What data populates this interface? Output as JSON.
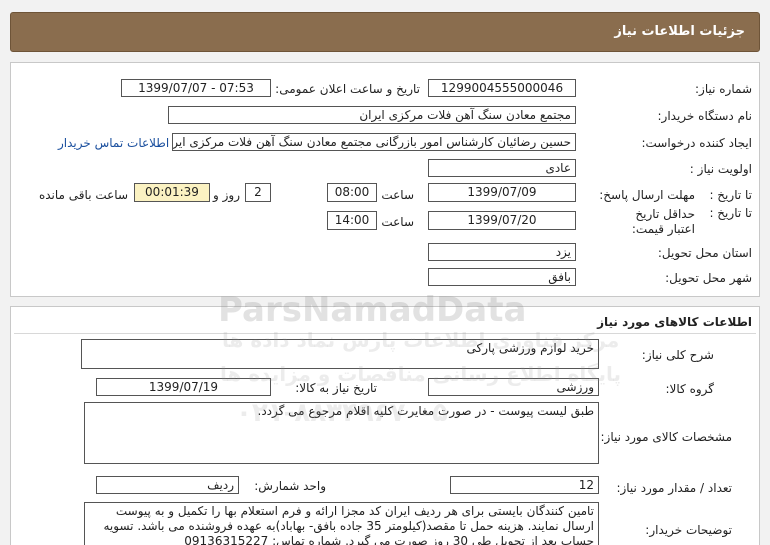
{
  "header": {
    "title": "جزئیات اطلاعات نیاز"
  },
  "general": {
    "need_number_label": "شماره نیاز:",
    "need_number": "1299004555000046",
    "announce_label": "تاریخ و ساعت اعلان عمومی:",
    "announce_value": "1399/07/07 - 07:53",
    "buyer_org_label": "نام دستگاه خریدار:",
    "buyer_org": "مجتمع معادن سنگ آهن فلات مرکزی ایران",
    "requester_label": "ایجاد کننده درخواست:",
    "requester": "حسین رضائیان کارشناس امور بازرگانی مجتمع معادن سنگ آهن فلات مرکزی ایران",
    "contact_link": "اطلاعات تماس خریدار",
    "priority_label": "اولویت نیاز :",
    "priority": "عادی",
    "deadline_label": "مهلت ارسال پاسخ:",
    "to_date_label": "تا تاریخ :",
    "deadline_date": "1399/07/09",
    "time_label": "ساعت",
    "deadline_time": "08:00",
    "days_value": "2",
    "days_label": "روز و",
    "remaining_value": "00:01:39",
    "remaining_label": "ساعت باقی مانده",
    "validity_label": "حداقل تاریخ اعتبار قیمت:",
    "validity_date": "1399/07/20",
    "validity_time": "14:00",
    "province_label": "استان محل تحویل:",
    "province": "یزد",
    "city_label": "شهر محل تحویل:",
    "city": "بافق"
  },
  "goods": {
    "section_title": "اطلاعات کالاهای مورد نیاز",
    "summary_label": "شرح کلی نیاز:",
    "summary": "خرید لوازم ورزشی پارکی",
    "group_label": "گروه کالا:",
    "group": "ورزشی",
    "need_date_label": "تاریخ نیاز به کالا:",
    "need_date": "1399/07/19",
    "specs_label": "مشخصات کالای مورد نیاز:",
    "specs": "طبق لیست پیوست - در صورت مغایرت کلیه اقلام مرجوع می گردد.",
    "qty_label": "تعداد / مقدار مورد نیاز:",
    "qty": "12",
    "unit_label": "واحد شمارش:",
    "unit": "ردیف",
    "notes_label": "توضیحات خریدار:",
    "notes": "تامین کنندگان بایستی برای هر ردیف ایران کد مجزا ارائه و فرم استعلام بها را تکمیل و به پیوست ارسال نمایند. هزینه حمل تا مقصد(کیلومتر 35 جاده بافق- بهاباد)به عهده فروشنده می باشد. تسویه حساب بعد از تحویل طی 30 روز صورت می گیرد. شماره تماس: 09136315227"
  },
  "watermark": {
    "brand": "ParsNamadData",
    "line1": "مرکز فناوری اطلاعات پارس نماد داده ها",
    "line2": "پایگاه اطلاع رسانی مناقصات و مزایده ها",
    "phone": "۰۲۱-۸۸۳۴۹۶۷۰-۵"
  }
}
